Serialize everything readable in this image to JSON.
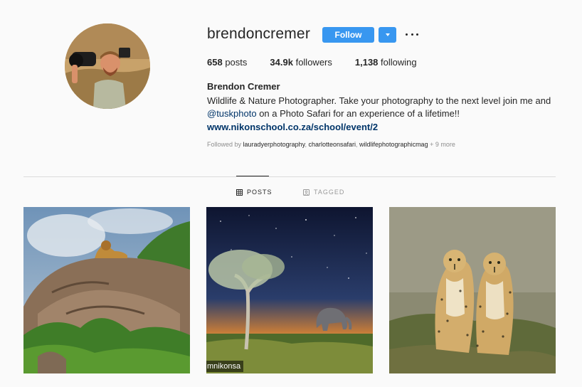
{
  "profile": {
    "username": "brendoncremer",
    "follow_label": "Follow",
    "stats": {
      "posts_count": "658",
      "posts_label": "posts",
      "followers_count": "34.9k",
      "followers_label": "followers",
      "following_count": "1,138",
      "following_label": "following"
    },
    "full_name": "Brendon Cremer",
    "bio_line1": "Wildlife & Nature Photographer. Take your photography to the next level join me and",
    "bio_mention": "@tuskphoto",
    "bio_line2_rest": " on a Photo Safari for an experience of a lifetime!!",
    "website": "www.nikonschool.co.za/school/event/2",
    "followed_by": {
      "prefix": "Followed by ",
      "accounts": [
        "lauradyerphotography",
        "charlotteonsafari",
        "wildlifephotographicmag"
      ],
      "more": " + 9 more"
    }
  },
  "tabs": {
    "posts": "POSTS",
    "tagged": "TAGGED"
  },
  "posts": [
    {
      "icon": "lion-on-rock-photo"
    },
    {
      "icon": "elephant-night-sky-photo",
      "watermark": "mnikonsa"
    },
    {
      "icon": "two-cheetahs-photo"
    }
  ],
  "colors": {
    "accent": "#3897f0",
    "link": "#003569",
    "muted": "#8e8e8e",
    "divider": "#dbdbdb",
    "background": "#fafafa"
  }
}
